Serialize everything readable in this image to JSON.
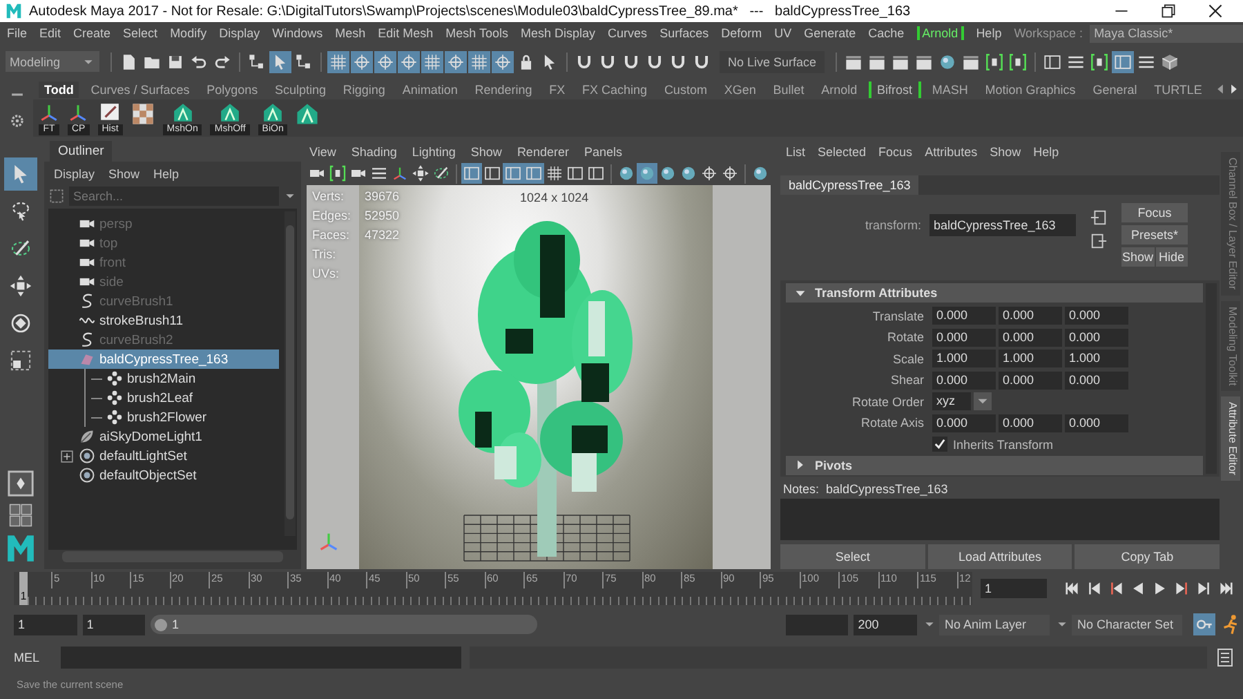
{
  "window": {
    "title": "Autodesk Maya 2017 - Not for Resale: G:\\DigitalTutors\\Swamp\\Projects\\scenes\\Module03\\baldCypressTree_89.ma*   ---   baldCypressTree_163"
  },
  "menu_bar": {
    "items": [
      {
        "label": "File",
        "kind": "menu"
      },
      {
        "label": "Edit",
        "kind": "menu"
      },
      {
        "label": "Create",
        "kind": "menu"
      },
      {
        "label": "Select",
        "kind": "menu"
      },
      {
        "label": "Modify",
        "kind": "menu"
      },
      {
        "label": "Display",
        "kind": "menu"
      },
      {
        "label": "Windows",
        "kind": "menu"
      },
      {
        "label": "Mesh",
        "kind": "menu"
      },
      {
        "label": "Edit Mesh",
        "kind": "menu"
      },
      {
        "label": "Mesh Tools",
        "kind": "menu"
      },
      {
        "label": "Mesh Display",
        "kind": "menu"
      },
      {
        "label": "Curves",
        "kind": "menu"
      },
      {
        "label": "Surfaces",
        "kind": "menu"
      },
      {
        "label": "Deform",
        "kind": "menu"
      },
      {
        "label": "UV",
        "kind": "menu"
      },
      {
        "label": "Generate",
        "kind": "menu"
      },
      {
        "label": "Cache",
        "kind": "menu"
      },
      {
        "label": "Arnold",
        "kind": "plugin"
      },
      {
        "label": "Help",
        "kind": "menu"
      }
    ],
    "workspace": {
      "label": "Workspace :",
      "value": "Maya Classic*"
    }
  },
  "status_line": {
    "menu_set": "Modeling",
    "buttons_left": [
      {
        "kind": "document",
        "on": false
      },
      {
        "kind": "folder",
        "on": false
      },
      {
        "kind": "save",
        "on": false
      },
      {
        "kind": "undo",
        "on": false
      },
      {
        "kind": "redo",
        "on": false
      },
      {
        "kind": "separator"
      },
      {
        "kind": "hierarchy",
        "on": false
      },
      {
        "kind": "cursor",
        "on": true
      },
      {
        "kind": "hierarchy",
        "on": false
      },
      {
        "kind": "separator"
      },
      {
        "kind": "grid",
        "on": true
      },
      {
        "kind": "crosshair",
        "on": true
      },
      {
        "kind": "crosshair",
        "on": true
      },
      {
        "kind": "crosshair",
        "on": true
      },
      {
        "kind": "grid",
        "on": true
      },
      {
        "kind": "crosshair",
        "on": true
      },
      {
        "kind": "grid",
        "on": true
      },
      {
        "kind": "crosshair",
        "on": true
      },
      {
        "kind": "lock",
        "on": false
      },
      {
        "kind": "cursor",
        "on": false
      },
      {
        "kind": "separator"
      },
      {
        "kind": "magnet",
        "on": false
      },
      {
        "kind": "magnet",
        "on": false
      },
      {
        "kind": "magnet",
        "on": false
      },
      {
        "kind": "magnet",
        "on": false
      },
      {
        "kind": "magnet",
        "on": false
      },
      {
        "kind": "magnet",
        "on": false
      }
    ],
    "live_surface": "No Live Surface",
    "buttons_right": [
      {
        "kind": "separator"
      },
      {
        "kind": "clapper",
        "on": false
      },
      {
        "kind": "clapper",
        "on": false
      },
      {
        "kind": "clapper",
        "on": false
      },
      {
        "kind": "clapper",
        "on": false
      },
      {
        "kind": "sphere",
        "on": false
      },
      {
        "kind": "clapper",
        "on": false
      },
      {
        "kind": "bracket",
        "on": false
      },
      {
        "kind": "bracket",
        "on": false
      },
      {
        "kind": "separator"
      },
      {
        "kind": "panel",
        "on": false
      },
      {
        "kind": "list",
        "on": false
      },
      {
        "kind": "bracket",
        "on": false
      },
      {
        "kind": "panel",
        "on": true
      },
      {
        "kind": "list",
        "on": false
      },
      {
        "kind": "cube",
        "on": false
      }
    ]
  },
  "shelf": {
    "tabs": [
      {
        "label": "Todd",
        "kind": "tab",
        "selected": true
      },
      {
        "label": "Curves / Surfaces",
        "kind": "tab",
        "selected": false
      },
      {
        "label": "Polygons",
        "kind": "tab",
        "selected": false
      },
      {
        "label": "Sculpting",
        "kind": "tab",
        "selected": false
      },
      {
        "label": "Rigging",
        "kind": "tab",
        "selected": false
      },
      {
        "label": "Animation",
        "kind": "tab",
        "selected": false
      },
      {
        "label": "Rendering",
        "kind": "tab",
        "selected": false
      },
      {
        "label": "FX",
        "kind": "tab",
        "selected": false
      },
      {
        "label": "FX Caching",
        "kind": "tab",
        "selected": false
      },
      {
        "label": "Custom",
        "kind": "tab",
        "selected": false
      },
      {
        "label": "XGen",
        "kind": "tab",
        "selected": false
      },
      {
        "label": "Bullet",
        "kind": "tab",
        "selected": false
      },
      {
        "label": "Arnold",
        "kind": "tab",
        "selected": false
      },
      {
        "label": "Bifrost",
        "kind": "plugin",
        "selected": false
      },
      {
        "label": "MASH",
        "kind": "tab",
        "selected": false
      },
      {
        "label": "Motion Graphics",
        "kind": "tab",
        "selected": false
      },
      {
        "label": "General",
        "kind": "tab",
        "selected": false
      },
      {
        "label": "TURTLE",
        "kind": "tab",
        "selected": false
      }
    ],
    "items": [
      {
        "kind": "axes",
        "label": "FT"
      },
      {
        "kind": "axes",
        "label": "CP"
      },
      {
        "kind": "notepad",
        "label": "Hist"
      },
      {
        "kind": "checker"
      },
      {
        "kind": "house",
        "label": "MshOn"
      },
      {
        "kind": "house",
        "label": "MshOff"
      },
      {
        "kind": "house",
        "label": "BiOn"
      },
      {
        "kind": "house"
      }
    ]
  },
  "toolbox": {
    "tools": [
      {
        "kind": "cursor",
        "selected": true
      },
      {
        "kind": "lasso",
        "selected": false
      },
      {
        "kind": "brush",
        "selected": false
      },
      {
        "kind": "move",
        "selected": false
      },
      {
        "kind": "rotate",
        "selected": false
      },
      {
        "kind": "scale",
        "selected": false
      }
    ]
  },
  "outliner": {
    "title": "Outliner",
    "menus": [
      "Display",
      "Show",
      "Help"
    ],
    "search": {
      "placeholder": "Search..."
    },
    "items": [
      {
        "label": "persp",
        "kind": "camera",
        "hidden": true,
        "selected": false
      },
      {
        "label": "top",
        "kind": "camera",
        "hidden": true,
        "selected": false
      },
      {
        "label": "front",
        "kind": "camera",
        "hidden": true,
        "selected": false
      },
      {
        "label": "side",
        "kind": "camera",
        "hidden": true,
        "selected": false
      },
      {
        "label": "curveBrush1",
        "kind": "curve",
        "hidden": true,
        "selected": false
      },
      {
        "label": "strokeBrush11",
        "kind": "stroke",
        "hidden": false,
        "selected": false
      },
      {
        "label": "curveBrush2",
        "kind": "curve",
        "hidden": true,
        "selected": false
      },
      {
        "label": "baldCypressTree_163",
        "kind": "mesh",
        "hidden": false,
        "selected": true,
        "expanded": true,
        "children": [
          {
            "label": "brush2Main",
            "kind": "group",
            "hidden": false,
            "selected": false
          },
          {
            "label": "brush2Leaf",
            "kind": "group",
            "hidden": false,
            "selected": false
          },
          {
            "label": "brush2Flower",
            "kind": "group",
            "hidden": false,
            "selected": false
          }
        ]
      },
      {
        "label": "aiSkyDomeLight1",
        "kind": "light",
        "hidden": false,
        "selected": false
      },
      {
        "label": "defaultLightSet",
        "kind": "set",
        "hidden": false,
        "selected": false,
        "expanded": false
      },
      {
        "label": "defaultObjectSet",
        "kind": "set",
        "hidden": false,
        "selected": false
      }
    ]
  },
  "viewport": {
    "menus": [
      "View",
      "Shading",
      "Lighting",
      "Show",
      "Renderer",
      "Panels"
    ],
    "toolbar": [
      {
        "kind": "camera",
        "on": false
      },
      {
        "kind": "bracket",
        "on": false
      },
      {
        "kind": "camera",
        "on": false
      },
      {
        "kind": "list",
        "on": false
      },
      {
        "kind": "axes",
        "on": false
      },
      {
        "kind": "move",
        "on": false
      },
      {
        "kind": "brush",
        "on": false
      },
      {
        "kind": "separator"
      },
      {
        "kind": "panel",
        "on": true
      },
      {
        "kind": "panel",
        "on": false
      },
      {
        "kind": "panel",
        "on": true
      },
      {
        "kind": "panel",
        "on": true
      },
      {
        "kind": "grid",
        "on": false
      },
      {
        "kind": "panel",
        "on": false
      },
      {
        "kind": "panel",
        "on": false
      },
      {
        "kind": "separator"
      },
      {
        "kind": "sphere",
        "on": false
      },
      {
        "kind": "sphere",
        "on": true
      },
      {
        "kind": "sphere",
        "on": false
      },
      {
        "kind": "sphere",
        "on": false
      },
      {
        "kind": "crosshair",
        "on": false
      },
      {
        "kind": "crosshair",
        "on": false
      },
      {
        "kind": "separator"
      },
      {
        "kind": "sphere",
        "on": false
      }
    ],
    "hud": [
      {
        "label": "Verts:",
        "value": "39676"
      },
      {
        "label": "Edges:",
        "value": "52950"
      },
      {
        "label": "Faces:",
        "value": "47322"
      },
      {
        "label": "Tris:"
      },
      {
        "label": "UVs:"
      }
    ],
    "resolution": "1024 x 1024"
  },
  "attribute_editor": {
    "menus": [
      "List",
      "Selected",
      "Focus",
      "Attributes",
      "Show",
      "Help"
    ],
    "node_tab": "baldCypressTree_163",
    "node_type": "transform:",
    "node_name": "baldCypressTree_163",
    "buttons": [
      "Focus",
      "Presets*",
      "Show",
      "Hide"
    ],
    "sections": [
      {
        "title": "Transform Attributes",
        "expanded": true,
        "attributes": [
          {
            "kind": "vector",
            "label": "Translate",
            "values": [
              "0.000",
              "0.000",
              "0.000"
            ]
          },
          {
            "kind": "vector",
            "label": "Rotate",
            "values": [
              "0.000",
              "0.000",
              "0.000"
            ]
          },
          {
            "kind": "vector",
            "label": "Scale",
            "values": [
              "1.000",
              "1.000",
              "1.000"
            ]
          },
          {
            "kind": "vector",
            "label": "Shear",
            "values": [
              "0.000",
              "0.000",
              "0.000"
            ]
          },
          {
            "kind": "enum",
            "label": "Rotate Order",
            "value": "xyz"
          },
          {
            "kind": "vector",
            "label": "Rotate Axis",
            "values": [
              "0.000",
              "0.000",
              "0.000"
            ]
          },
          {
            "kind": "checkbox",
            "label": "Inherits Transform",
            "checked": true
          }
        ]
      },
      {
        "title": "Pivots",
        "expanded": false
      }
    ],
    "notes_label": "Notes:  baldCypressTree_163",
    "bottom_buttons": [
      "Select",
      "Load Attributes",
      "Copy Tab"
    ]
  },
  "side_tabs": [
    {
      "label": "Channel Box / Layer Editor",
      "selected": false
    },
    {
      "label": "Modeling Toolkit",
      "selected": false
    },
    {
      "label": "Attribute Editor",
      "selected": true
    }
  ],
  "time_slider": {
    "current_frame": "1",
    "level": 0,
    "ticks": [
      "5",
      "10",
      "15",
      "20",
      "25",
      "30",
      "35",
      "40",
      "45",
      "50",
      "55",
      "60",
      "65",
      "70",
      "75",
      "80",
      "85",
      "90",
      "95",
      "100",
      "105",
      "110",
      "115",
      "12"
    ],
    "frame_field": "1"
  },
  "range_slider": {
    "start": "1",
    "playback_start": "1",
    "bar_label": "1",
    "end_field": "200",
    "anim_layer": "No Anim Layer",
    "character_set": "No Character Set"
  },
  "command_line": {
    "language": "MEL"
  },
  "help_line": "Save the current scene"
}
